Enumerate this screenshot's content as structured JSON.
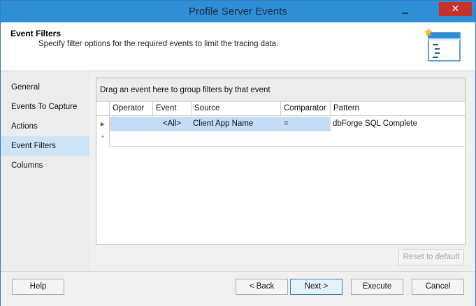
{
  "window": {
    "title": "Profile Server Events",
    "close_glyph": "✕"
  },
  "header": {
    "title": "Event Filters",
    "subtitle": "Specify filter options for the required events to limit the tracing data.",
    "icon": "filter-document-icon"
  },
  "nav": {
    "items": [
      {
        "label": "General"
      },
      {
        "label": "Events To Capture"
      },
      {
        "label": "Actions"
      },
      {
        "label": "Event Filters",
        "active": true
      },
      {
        "label": "Columns"
      }
    ]
  },
  "grid": {
    "group_hint": "Drag an event here to group filters by that event",
    "columns": [
      "Operator",
      "Event",
      "Source",
      "Comparator",
      "Pattern"
    ],
    "rows": [
      {
        "operator": "",
        "event": "<All>",
        "source": "Client App Name",
        "comparator": "=",
        "pattern": "dbForge SQL Complete"
      }
    ],
    "current_row_glyph": "▶",
    "new_row_glyph": "*"
  },
  "buttons": {
    "reset": "Reset to default",
    "help": "Help",
    "back": "< Back",
    "next": "Next >",
    "execute": "Execute",
    "cancel": "Cancel"
  },
  "colors": {
    "titlebar": "#2f8fd6",
    "selection": "#c4dcf5",
    "close": "#c7312c"
  }
}
